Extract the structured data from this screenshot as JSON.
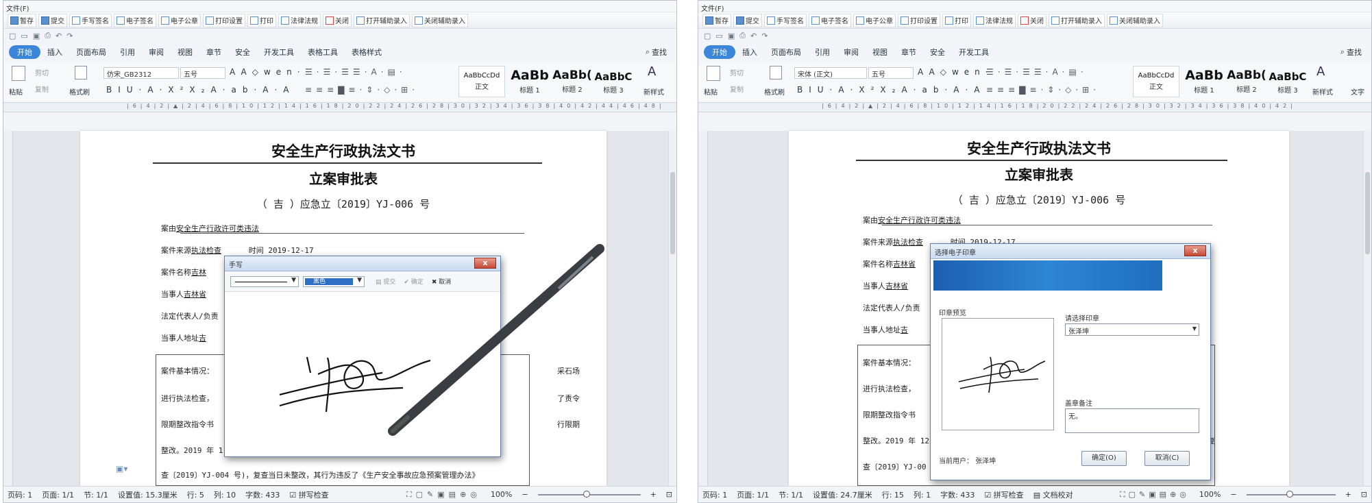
{
  "menu_file": "文件(F)",
  "addin_buttons": [
    "暂存",
    "提交",
    "手写签名",
    "电子签名",
    "电子公章",
    "打印设置",
    "打印",
    "法律法规",
    "关闭",
    "打开辅助录入",
    "关闭辅助录入"
  ],
  "tabs_left": [
    "开始",
    "插入",
    "页面布局",
    "引用",
    "审阅",
    "视图",
    "章节",
    "安全",
    "开发工具",
    "表格工具",
    "表格样式"
  ],
  "tabs_right": [
    "开始",
    "插入",
    "页面布局",
    "引用",
    "审阅",
    "视图",
    "章节",
    "安全",
    "开发工具"
  ],
  "find_label": "查找",
  "ribbon": {
    "paste": "粘贴",
    "cut": "剪切",
    "copy": "复制",
    "format_painter": "格式刷",
    "font_left": "仿宋_GB2312",
    "font_right": "宋体 (正文)",
    "size": "五号",
    "new_style": "新样式",
    "text_tool": "文字",
    "styles": [
      {
        "sample": "AaBbCcDd",
        "name": "正文"
      },
      {
        "sample": "AaBb",
        "name": "标题 1"
      },
      {
        "sample": "AaBb(",
        "name": "标题 2"
      },
      {
        "sample": "AaBbC",
        "name": "标题 3"
      }
    ]
  },
  "document": {
    "title": "安全生产行政执法文书",
    "subtitle": "立案审批表",
    "case_no": "（ 吉 ）应急立〔2019〕YJ-006 号",
    "reason_label": "案由",
    "reason_value": "安全生产行政许可类违法",
    "source_label": "案件来源",
    "source_value": "执法检查",
    "time_label": "时间",
    "time_value": "2019-12-17",
    "name_label": "案件名称",
    "name_value_prefix": "吉林",
    "name_value_prefix_r": "吉林省",
    "party_label": "当事人",
    "party_value_prefix": "吉林省",
    "legal_rep_label": "法定代表人/负责",
    "address_label": "当事人地址",
    "address_value_prefix": "吉",
    "basic_left": [
      "案件基本情况：",
      "进行执法检查，",
      "限期整改指令书",
      "整改。2019 年 1",
      "查〔2019〕YJ-004 号)，复查当日未整改，其行为违反了《生产安全事故应急预案管理办法》"
    ],
    "basic_left_right_frag": [
      "采石场",
      "了责令",
      "行限期"
    ],
    "basic_right": [
      "案件基本情况：",
      "进行执法检查，",
      "限期整改指令书",
      "整改。2019 年 12",
      "查〔2019〕YJ-00"
    ],
    "basic_right_frag": [
      "急复"
    ]
  },
  "handwrite": {
    "title": "手写",
    "color_label": "黑色",
    "submit": "提交",
    "confirm": "确定",
    "cancel": "取消"
  },
  "seal_dialog": {
    "title": "选择电子印章",
    "preview_label": "印章预览",
    "choose_label": "请选择印章",
    "selected_seal": "张泽坤",
    "remark_label": "盖章备注",
    "remark_value": "无。",
    "current_user_label": "当前用户：",
    "current_user": "张泽坤",
    "ok": "确定(O)",
    "cancel": "取消(C)"
  },
  "status_left": {
    "page": "页码: 1",
    "pages": "页面: 1/1",
    "section": "节: 1/1",
    "set_value": "设置值: 15.3厘米",
    "row": "行: 5",
    "col": "列: 10",
    "words": "字数: 433",
    "spell": "拼写检查",
    "zoom": "100%"
  },
  "status_right": {
    "page": "页码: 1",
    "pages": "页面: 1/1",
    "section": "节: 1/1",
    "set_value": "设置值: 24.7厘米",
    "row": "行: 15",
    "col": "列: 1",
    "words": "字数: 433",
    "spell": "拼写检查",
    "proof": "文档校对",
    "zoom": "100%"
  }
}
